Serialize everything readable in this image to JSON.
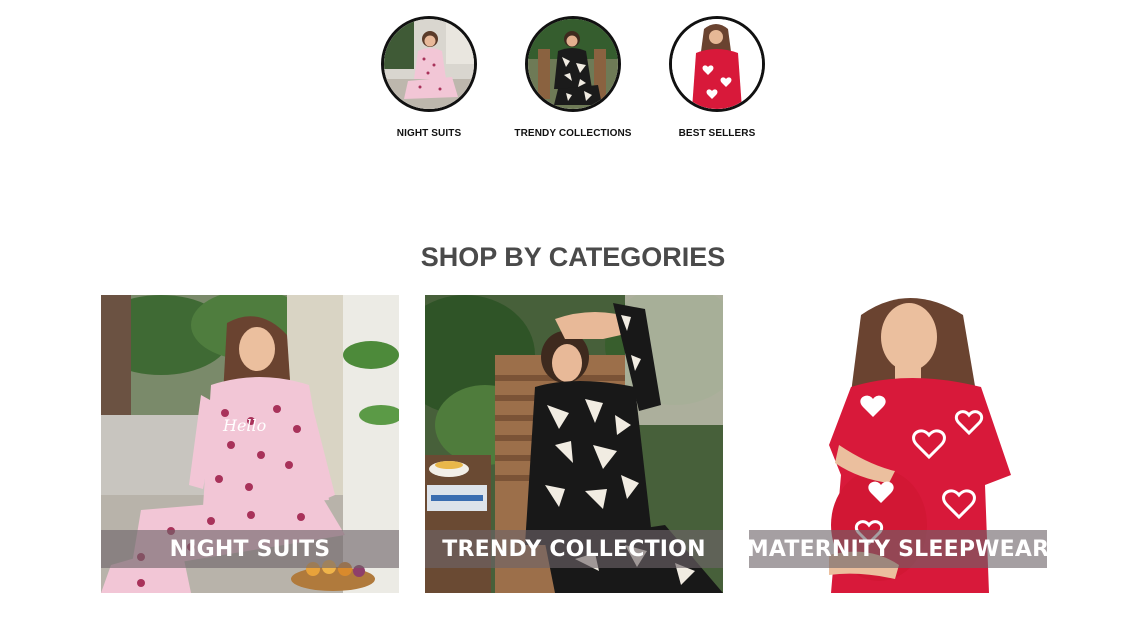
{
  "stories": [
    {
      "label": "NIGHT SUITS"
    },
    {
      "label": "TRENDY COLLECTIONS"
    },
    {
      "label": "BEST SELLERS"
    }
  ],
  "section": {
    "title": "SHOP BY CATEGORIES"
  },
  "categories": [
    {
      "label": "NIGHT SUITS"
    },
    {
      "label": "TRENDY COLLECTION"
    },
    {
      "label": "MATERNITY SLEEPWEAR"
    }
  ],
  "colors": {
    "heading": "#4a4a4a",
    "banner": "#6e6469",
    "pink_pajama": "#f2c6d6",
    "maternity_red": "#d8193a"
  }
}
